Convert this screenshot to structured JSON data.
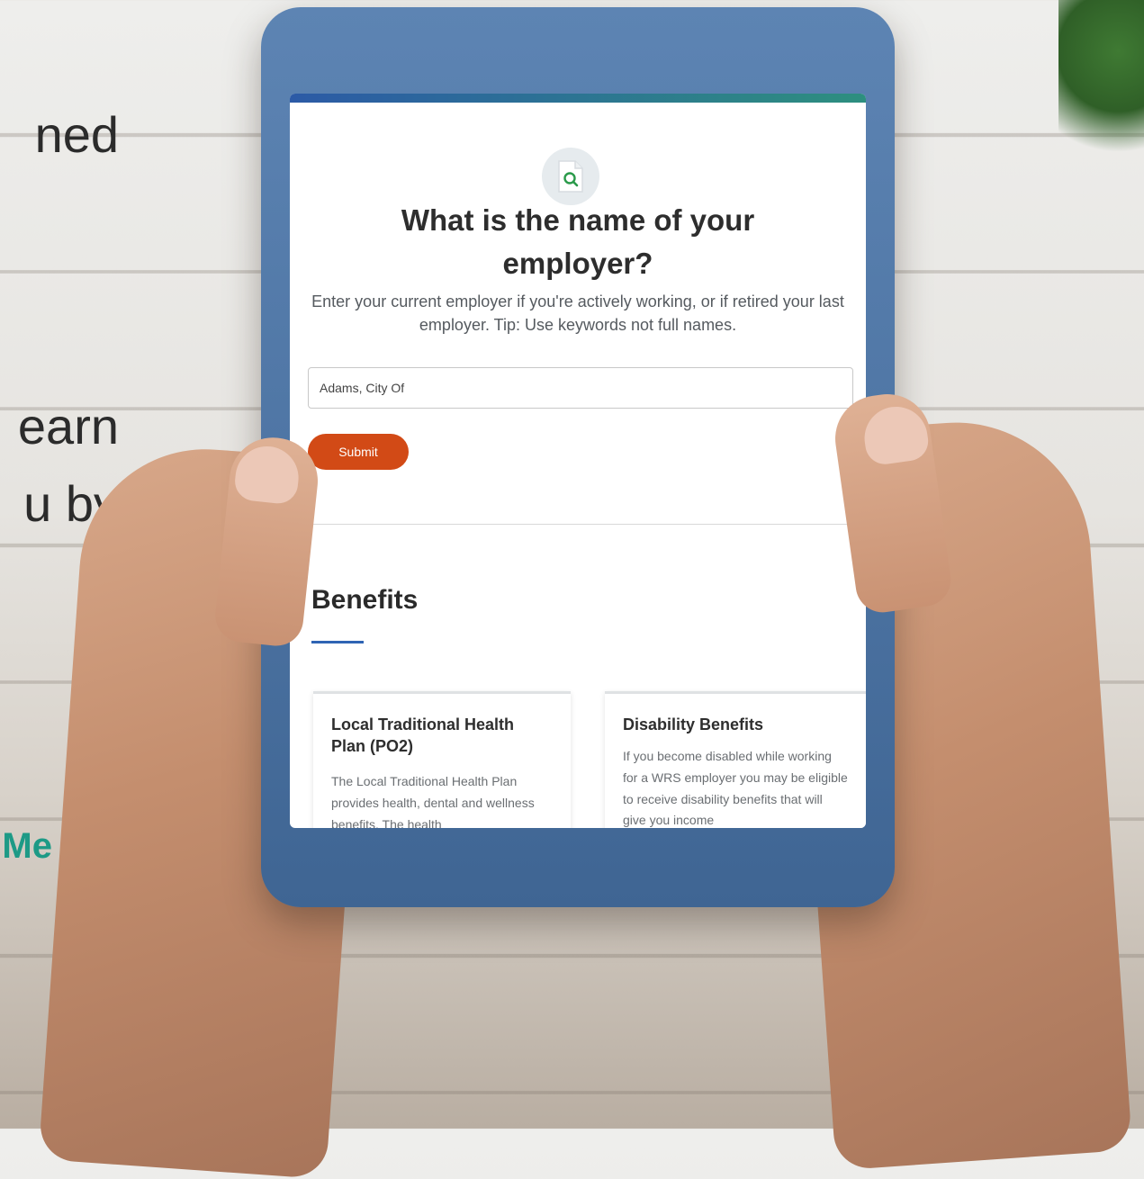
{
  "left_text": {
    "line1": "ned",
    "line2": "earn",
    "line3": "u by",
    "cta": "Me"
  },
  "form": {
    "icon": "document-search-icon",
    "title_line1": "What is the name of your",
    "title_line2": "employer?",
    "subtitle": "Enter your current employer if you're actively working, or if retired your last employer. Tip: Use keywords not full names.",
    "employer_value": "Adams, City Of",
    "submit_label": "Submit"
  },
  "benefits": {
    "heading": "Benefits",
    "cards": [
      {
        "title": "Local Traditional Health Plan (PO2)",
        "body": "The Local Traditional Health Plan provides health, dental and wellness benefits. The health"
      },
      {
        "title": "Disability Benefits",
        "body": "If you become disabled while working for a WRS employer you may be eligible to receive disability benefits that will give you income"
      }
    ]
  },
  "colors": {
    "accent_blue": "#2f64b4",
    "submit_orange": "#d24a16",
    "cta_teal": "#1d9a86",
    "tablet_frame": "#4d74a3"
  }
}
